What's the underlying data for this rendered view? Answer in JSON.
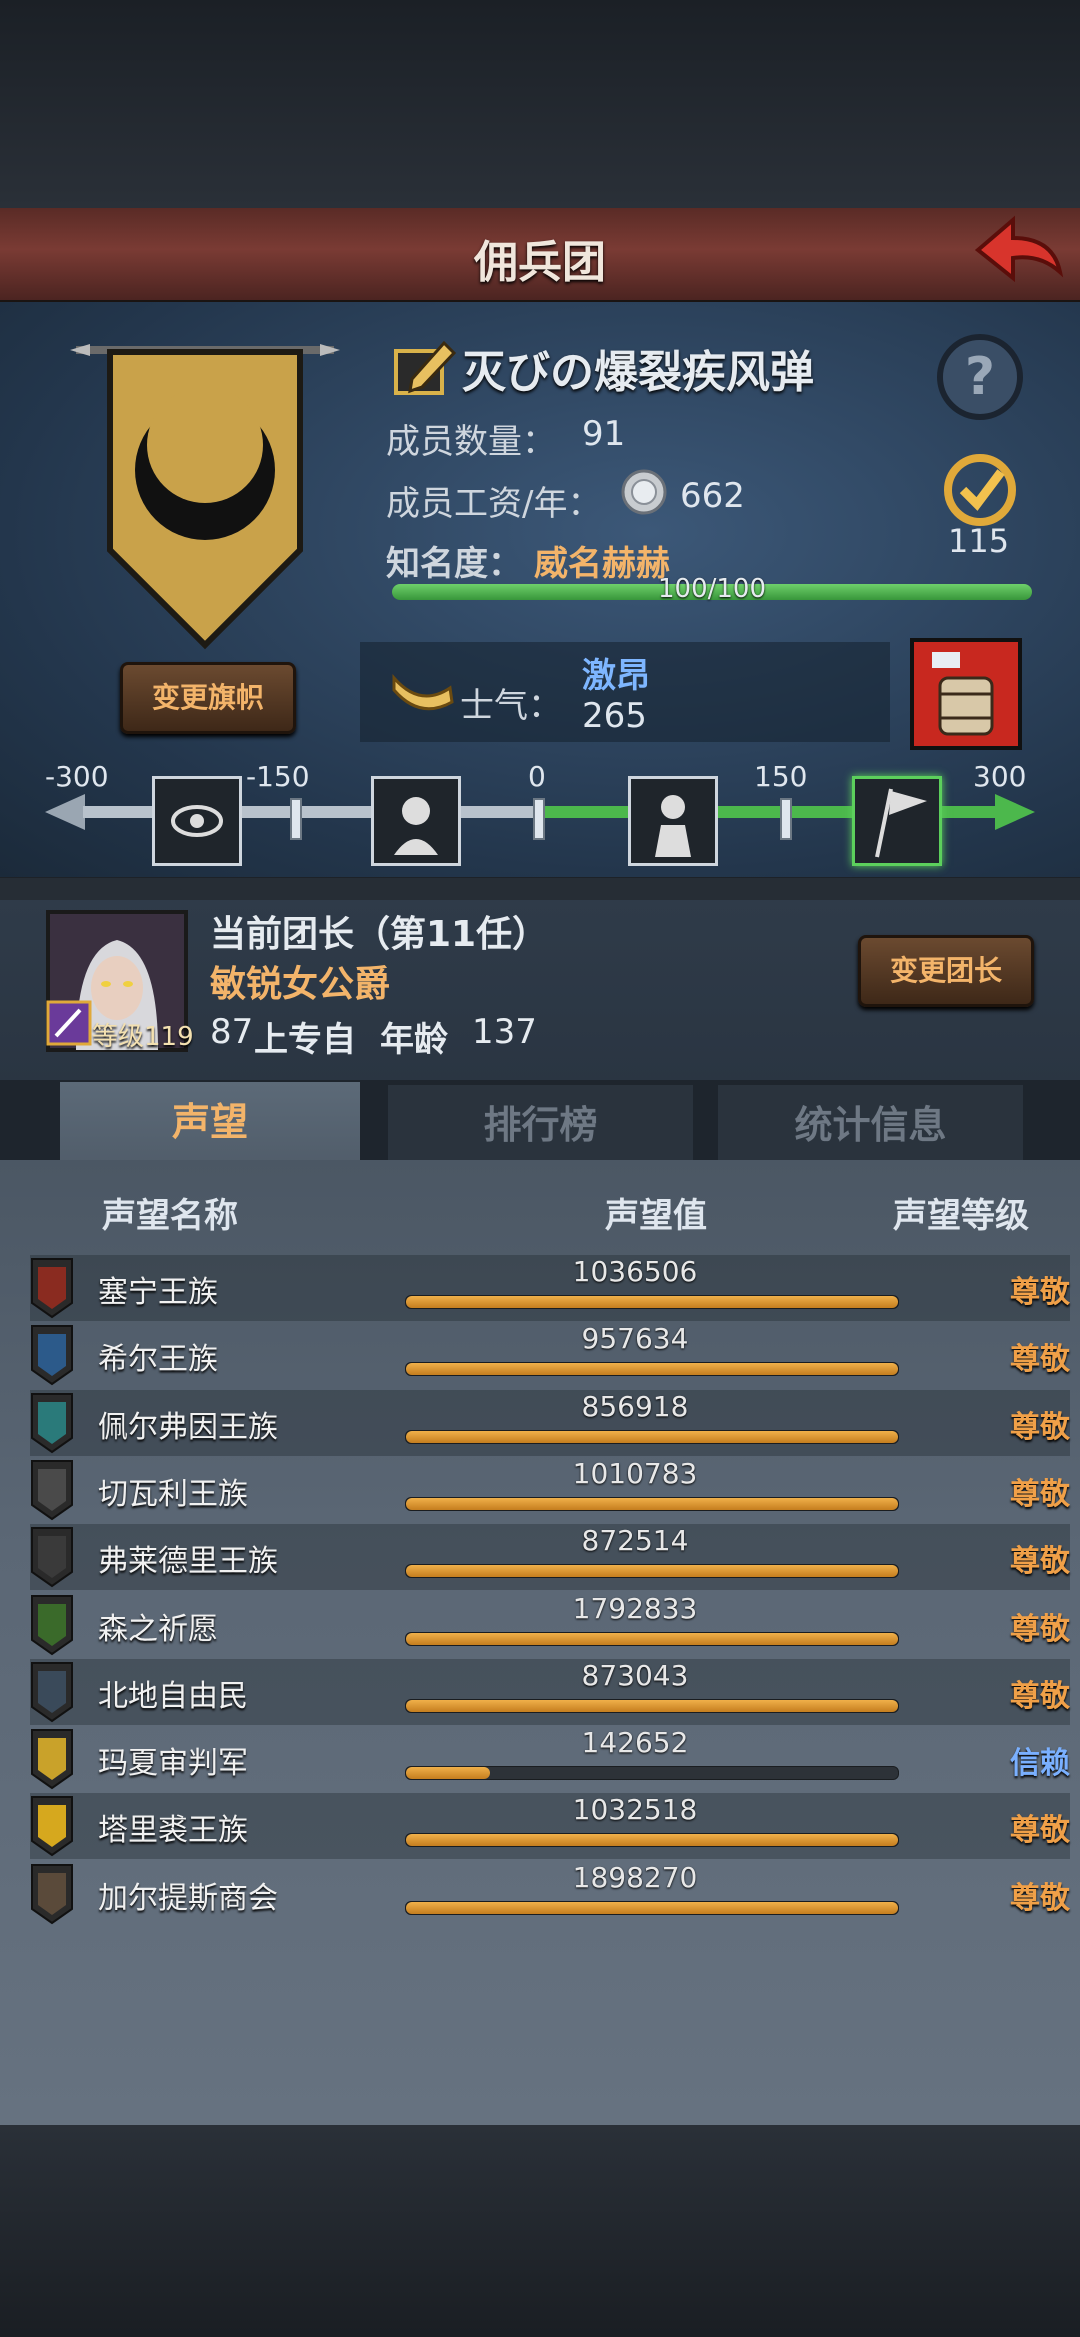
{
  "header": {
    "title": "佣兵团"
  },
  "guild": {
    "name": "灭びの爆裂疾风弹",
    "members_label": "成员数量：",
    "members_value": "91",
    "salary_label": "成员工资/年：",
    "salary_value": "662",
    "fame_label": "知名度：",
    "fame_value": "威名赫赫",
    "fame_progress_text": "100/100",
    "fame_progress": 1.0,
    "rating_value": "115",
    "change_banner_label": "变更旗帜",
    "morale_label": "士气：",
    "morale_state": "激昂",
    "morale_value": "265"
  },
  "morale_scale": {
    "labels": [
      "-300",
      "-150",
      "0",
      "150",
      "300"
    ],
    "min": -300,
    "max": 300,
    "current": 265
  },
  "leader": {
    "title": "当前团长（第11任）",
    "name": "敏锐女公爵",
    "level_text": "等级119",
    "info_number": "87",
    "info_text": "上专自",
    "age_label": "年龄",
    "age_value": "137",
    "change_leader_label": "变更团长"
  },
  "tabs": [
    {
      "label": "声望",
      "active": true
    },
    {
      "label": "排行榜",
      "active": false
    },
    {
      "label": "统计信息",
      "active": false
    }
  ],
  "reputation": {
    "col_name": "声望名称",
    "col_value": "声望值",
    "col_level": "声望等级",
    "rows": [
      {
        "name": "塞宁王族",
        "value": "1036506",
        "level": "尊敬",
        "progress": 1.0,
        "crest_color": "#8a2b20"
      },
      {
        "name": "希尔王族",
        "value": "957634",
        "level": "尊敬",
        "progress": 1.0,
        "crest_color": "#2c5a8a"
      },
      {
        "name": "佩尔弗因王族",
        "value": "856918",
        "level": "尊敬",
        "progress": 1.0,
        "crest_color": "#2a7a7a"
      },
      {
        "name": "切瓦利王族",
        "value": "1010783",
        "level": "尊敬",
        "progress": 1.0,
        "crest_color": "#4a4a4a"
      },
      {
        "name": "弗莱德里王族",
        "value": "872514",
        "level": "尊敬",
        "progress": 1.0,
        "crest_color": "#3a3a3a"
      },
      {
        "name": "森之祈愿",
        "value": "1792833",
        "level": "尊敬",
        "progress": 1.0,
        "crest_color": "#3a6a2a"
      },
      {
        "name": "北地自由民",
        "value": "873043",
        "level": "尊敬",
        "progress": 1.0,
        "crest_color": "#3a4a5a"
      },
      {
        "name": "玛夏审判军",
        "value": "142652",
        "level": "信赖",
        "progress": 0.17,
        "crest_color": "#c9a22a"
      },
      {
        "name": "塔里裘王族",
        "value": "1032518",
        "level": "尊敬",
        "progress": 1.0,
        "crest_color": "#d6a81e"
      },
      {
        "name": "加尔提斯商会",
        "value": "1898270",
        "level": "尊敬",
        "progress": 1.0,
        "crest_color": "#5a4a3a"
      }
    ]
  },
  "colors": {
    "level_revered": "#f0a048",
    "level_trusted": "#7ab0ff",
    "accent_gold": "#f3b46a",
    "morale_green": "#4cb84c"
  }
}
